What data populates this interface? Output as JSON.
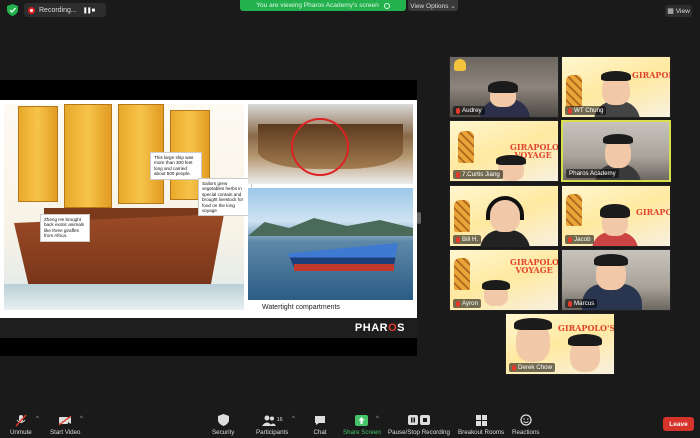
{
  "top_bar": {
    "recording_label": "Recording...",
    "recording_controls": "❚❚ ■",
    "viewing_banner": "You are viewing Pharos Academy's screen",
    "view_options_label": "View Options ⌄",
    "view_button_label": "View"
  },
  "shared_slide": {
    "callout_ship": "This large ship was more than 300 feet long and carried about 500 people.",
    "callout_sailors": "Sailors grew vegetables herbs in special contain and brought livestock for food on the long voyage",
    "callout_zheng_he": "Zheng He brought back exotic animals like three giraffes from Africa.",
    "caption": "Watertight compartments",
    "brand_left": "PHAR",
    "brand_o": "O",
    "brand_right": "S"
  },
  "poster": {
    "title_line1": "GIRAPOLO'S",
    "title_line2": "VOYAGE"
  },
  "participants": [
    {
      "name": "Audrey"
    },
    {
      "name": "WT Chung"
    },
    {
      "name": "7.Curtis Jiang"
    },
    {
      "name": "Pharos Academy"
    },
    {
      "name": "Bill H."
    },
    {
      "name": "Jacob"
    },
    {
      "name": "Ayron"
    },
    {
      "name": "Marcus"
    },
    {
      "name": "Derek Chow"
    }
  ],
  "toolbar": {
    "unmute": "Unmute",
    "start_video": "Start Video",
    "security": "Security",
    "participants": "Participants",
    "participants_count": "16",
    "chat": "Chat",
    "share_screen": "Share Screen",
    "pause_stop_recording": "Pause/Stop Recording",
    "breakout_rooms": "Breakout Rooms",
    "reactions": "Reactions",
    "leave": "Leave"
  },
  "colors": {
    "accent_green": "#23b14d",
    "leave_red": "#d6332a",
    "active_speaker": "#d9df4b"
  }
}
